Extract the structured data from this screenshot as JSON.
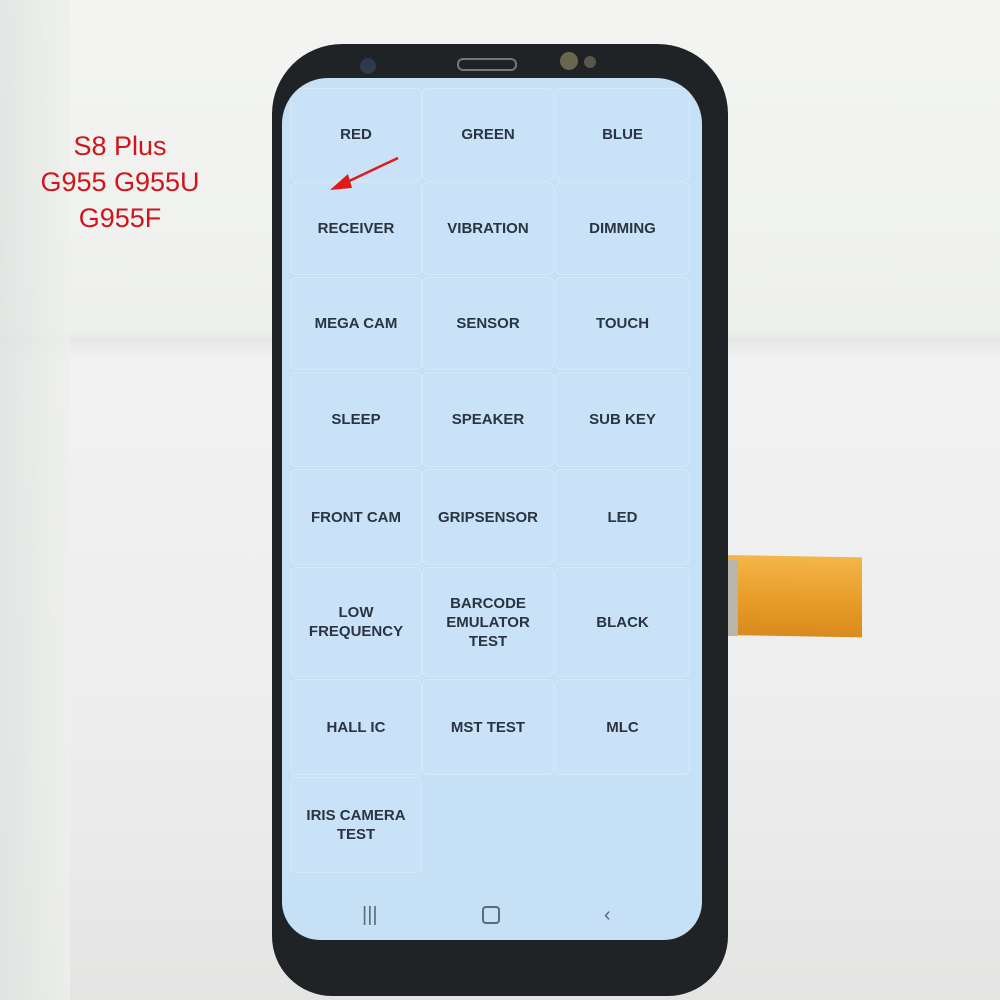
{
  "caption": {
    "lines": [
      "S8 Plus",
      "G955 G955U",
      "G955F"
    ],
    "color": "#d0161c"
  },
  "test_menu": {
    "items": [
      "RED",
      "GREEN",
      "BLUE",
      "RECEIVER",
      "VIBRATION",
      "DIMMING",
      "MEGA CAM",
      "SENSOR",
      "TOUCH",
      "SLEEP",
      "SPEAKER",
      "SUB KEY",
      "FRONT CAM",
      "GRIPSENSOR",
      "LED",
      "LOW FREQUENCY",
      "BARCODE EMULATOR TEST",
      "BLACK",
      "HALL IC",
      "MST TEST",
      "MLC",
      "IRIS CAMERA TEST"
    ],
    "background": "#c6e0f6"
  },
  "navbar": {
    "recents": "recents-icon",
    "home": "home-icon",
    "back": "back-icon"
  },
  "annotation": {
    "type": "arrow",
    "color": "#e01a1a"
  }
}
